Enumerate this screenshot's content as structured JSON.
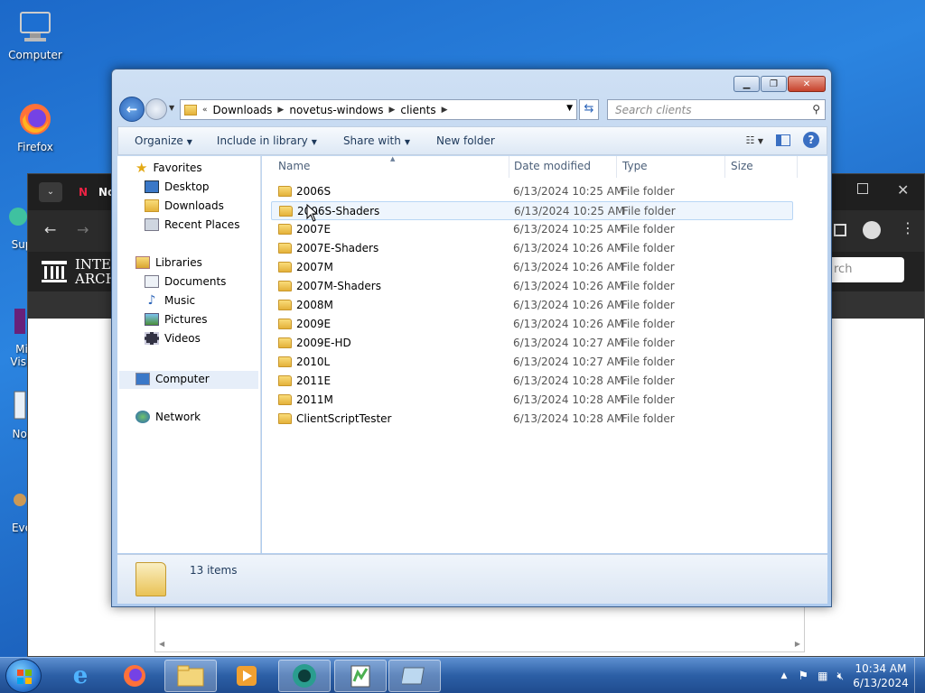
{
  "desktop": {
    "icons": [
      {
        "label": "Computer"
      },
      {
        "label": "Firefox"
      },
      {
        "label": "Sup"
      },
      {
        "label": "Mi\nVisu"
      },
      {
        "label": "Not"
      },
      {
        "label": "Eve"
      }
    ]
  },
  "browser": {
    "tab_partial": "No",
    "logo_partial": "INTE ARCH",
    "search_partial": "rch"
  },
  "explorer": {
    "breadcrumb": [
      "Downloads",
      "novetus-windows",
      "clients"
    ],
    "search_placeholder": "Search clients",
    "toolbar": {
      "organize": "Organize",
      "include_in_library": "Include in library",
      "share_with": "Share with",
      "new_folder": "New folder"
    },
    "nav": {
      "favorites": "Favorites",
      "desktop": "Desktop",
      "downloads": "Downloads",
      "recent_places": "Recent Places",
      "libraries": "Libraries",
      "documents": "Documents",
      "music": "Music",
      "pictures": "Pictures",
      "videos": "Videos",
      "computer": "Computer",
      "network": "Network"
    },
    "columns": {
      "name": "Name",
      "date_modified": "Date modified",
      "type": "Type",
      "size": "Size"
    },
    "files": [
      {
        "name": "2006S",
        "date": "6/13/2024 10:25 AM",
        "type": "File folder"
      },
      {
        "name": "2006S-Shaders",
        "date": "6/13/2024 10:25 AM",
        "type": "File folder"
      },
      {
        "name": "2007E",
        "date": "6/13/2024 10:25 AM",
        "type": "File folder"
      },
      {
        "name": "2007E-Shaders",
        "date": "6/13/2024 10:26 AM",
        "type": "File folder"
      },
      {
        "name": "2007M",
        "date": "6/13/2024 10:26 AM",
        "type": "File folder"
      },
      {
        "name": "2007M-Shaders",
        "date": "6/13/2024 10:26 AM",
        "type": "File folder"
      },
      {
        "name": "2008M",
        "date": "6/13/2024 10:26 AM",
        "type": "File folder"
      },
      {
        "name": "2009E",
        "date": "6/13/2024 10:26 AM",
        "type": "File folder"
      },
      {
        "name": "2009E-HD",
        "date": "6/13/2024 10:27 AM",
        "type": "File folder"
      },
      {
        "name": "2010L",
        "date": "6/13/2024 10:27 AM",
        "type": "File folder"
      },
      {
        "name": "2011E",
        "date": "6/13/2024 10:28 AM",
        "type": "File folder"
      },
      {
        "name": "2011M",
        "date": "6/13/2024 10:28 AM",
        "type": "File folder"
      },
      {
        "name": "ClientScriptTester",
        "date": "6/13/2024 10:28 AM",
        "type": "File folder"
      }
    ],
    "status": "13 items"
  },
  "taskbar": {
    "time": "10:34 AM",
    "date": "6/13/2024"
  }
}
